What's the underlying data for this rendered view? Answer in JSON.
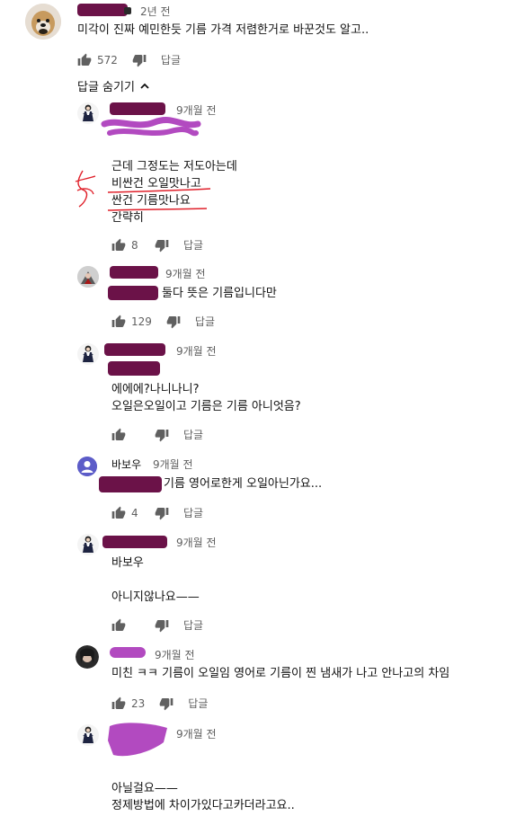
{
  "top_comment": {
    "time": "2년 전",
    "text": "미각이 진짜 예민한듯 기름 가격 저렴한거로 바꾼것도 알고..",
    "likes": "572",
    "reply_label": "답글"
  },
  "hide_replies_label": "답글 숨기기",
  "replies": [
    {
      "time": "9개월 전",
      "lines": [
        "근데 그정도는 저도아는데",
        "비싼건 오일맛나고",
        "싼건 기름맛나요",
        "간략히"
      ],
      "likes": "8",
      "reply_label": "답글"
    },
    {
      "time": "9개월 전",
      "lines": [
        "둘다 뜻은 기름입니다만"
      ],
      "likes": "129",
      "reply_label": "답글"
    },
    {
      "time": "9개월 전",
      "lines": [
        "에에에?나니나니?",
        "오일은오일이고 기름은 기름 아니엇음?"
      ],
      "likes": "",
      "reply_label": "답글"
    },
    {
      "author": "바보우",
      "time": "9개월 전",
      "lines": [
        "기름 영어로한게 오일아닌가요..."
      ],
      "likes": "4",
      "reply_label": "답글"
    },
    {
      "time": "9개월 전",
      "lines": [
        "바보우",
        "아니지않나요——"
      ],
      "likes": "",
      "reply_label": "답글"
    },
    {
      "time": "9개월 전",
      "lines": [
        "미친 ㅋㅋ 기름이 오일임 영어로 기름이 찐 냄새가 나고 안나고의 차임"
      ],
      "likes": "23",
      "reply_label": "답글"
    },
    {
      "time": "9개월 전",
      "lines": [
        "아닐걸요——",
        "정제방법에 차이가있다고카더라고요.."
      ]
    }
  ],
  "icons": {
    "like": "thumb-up-icon",
    "dislike": "thumb-down-icon",
    "collapse": "chevron-up-icon"
  },
  "colors": {
    "redact": "#6b1248",
    "scribble": "#b24ac0",
    "annotation": "#e0202a",
    "default_avatar": "#5c5cc8"
  }
}
